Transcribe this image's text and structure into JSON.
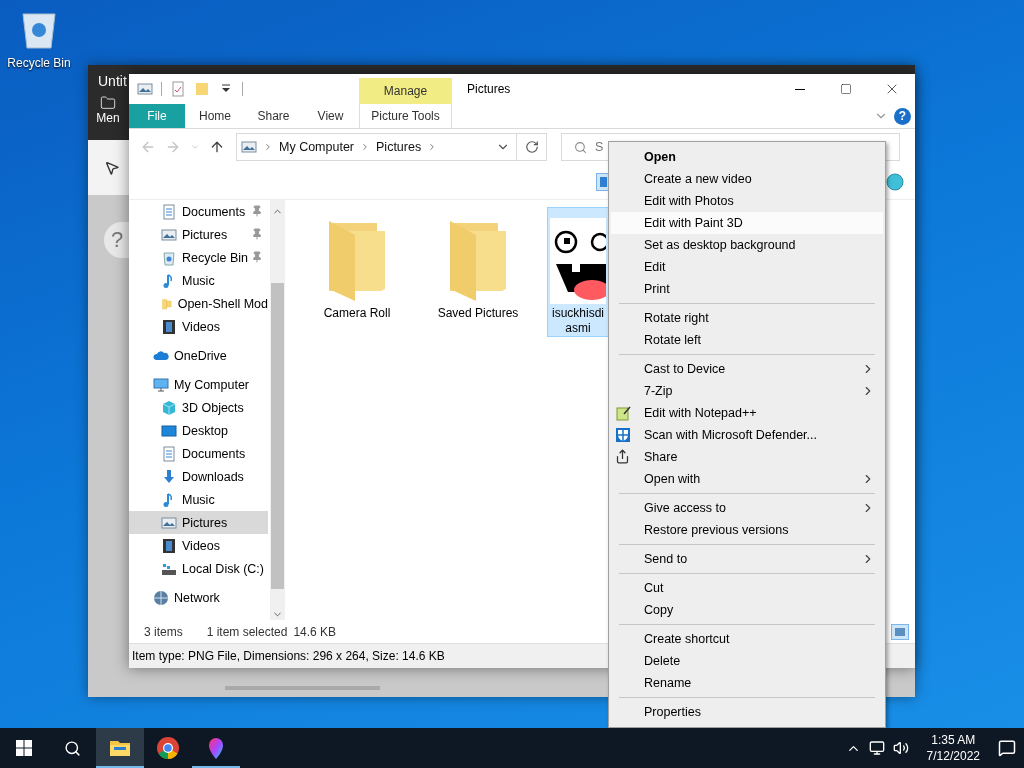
{
  "desktop": {
    "icons": [
      {
        "label": "Recycle Bin",
        "kind": "recycle"
      }
    ]
  },
  "background_window": {
    "title": "Untit",
    "menu_button": "Men",
    "help_button": "?"
  },
  "explorer": {
    "title": "Pictures",
    "help_icon": "?",
    "contextual_tab": {
      "header": "Manage",
      "tab": "Picture Tools"
    },
    "ribbon_tabs": [
      {
        "label": "File",
        "kind": "file",
        "selected": false
      },
      {
        "label": "Home",
        "kind": "plain",
        "selected": false
      },
      {
        "label": "Share",
        "kind": "plain",
        "selected": false
      },
      {
        "label": "View",
        "kind": "plain",
        "selected": false
      }
    ],
    "address": {
      "crumbs": [
        "My Computer",
        "Pictures"
      ]
    },
    "search": {
      "placeholder": "S"
    },
    "nav_pane": {
      "quick_access": [
        {
          "label": "Documents",
          "kind": "documents",
          "pinned": true,
          "selected": false
        },
        {
          "label": "Pictures",
          "kind": "pictures",
          "pinned": true,
          "selected": false
        },
        {
          "label": "Recycle Bin",
          "kind": "recycle",
          "pinned": true,
          "selected": false
        },
        {
          "label": "Music",
          "kind": "music",
          "pinned": false,
          "selected": false
        },
        {
          "label": "Open-Shell Mod",
          "kind": "folder",
          "pinned": false,
          "selected": false
        },
        {
          "label": "Videos",
          "kind": "videos",
          "pinned": false,
          "selected": false
        }
      ],
      "items": [
        {
          "label": "OneDrive",
          "kind": "onedrive",
          "selected": false
        },
        {
          "label": "My Computer",
          "kind": "computer",
          "selected": false,
          "children": [
            {
              "label": "3D Objects",
              "kind": "objects",
              "selected": false
            },
            {
              "label": "Desktop",
              "kind": "desktop",
              "selected": false
            },
            {
              "label": "Documents",
              "kind": "documents",
              "selected": false
            },
            {
              "label": "Downloads",
              "kind": "downloads",
              "selected": false
            },
            {
              "label": "Music",
              "kind": "music",
              "selected": false
            },
            {
              "label": "Pictures",
              "kind": "pictures",
              "selected": true
            },
            {
              "label": "Videos",
              "kind": "videos",
              "selected": false
            },
            {
              "label": "Local Disk (C:)",
              "kind": "disk",
              "selected": false
            }
          ]
        },
        {
          "label": "Network",
          "kind": "network",
          "selected": false
        }
      ]
    },
    "files": [
      {
        "name_lines": [
          "Camera Roll"
        ],
        "kind": "folder",
        "selected": false
      },
      {
        "name_lines": [
          "Saved Pictures"
        ],
        "kind": "folder",
        "selected": false
      },
      {
        "name_lines": [
          "isuckhisdi",
          "asmi"
        ],
        "selected": true
      }
    ],
    "status_bar": {
      "item_count": "3 items",
      "selection": "1 item selected",
      "size": "14.6 KB"
    },
    "details_pane": "Item type: PNG File, Dimensions: 296 x 264, Size: 14.6 KB"
  },
  "context_menu": {
    "groups": [
      [
        {
          "label": "Open",
          "kind": "plain",
          "bold": true,
          "highlighted": false,
          "submenu": false
        },
        {
          "label": "Create a new video",
          "kind": "plain",
          "bold": false,
          "highlighted": false,
          "submenu": false
        },
        {
          "label": "Edit with Photos",
          "kind": "plain",
          "bold": false,
          "highlighted": false,
          "submenu": false
        },
        {
          "label": "Edit with Paint 3D",
          "kind": "plain",
          "bold": false,
          "highlighted": true,
          "submenu": false
        },
        {
          "label": "Set as desktop background",
          "kind": "plain",
          "bold": false,
          "highlighted": false,
          "submenu": false
        },
        {
          "label": "Edit",
          "kind": "plain",
          "bold": false,
          "highlighted": false,
          "submenu": false
        },
        {
          "label": "Print",
          "kind": "plain",
          "bold": false,
          "highlighted": false,
          "submenu": false
        }
      ],
      [
        {
          "label": "Rotate right",
          "kind": "plain",
          "bold": false,
          "highlighted": false,
          "submenu": false
        },
        {
          "label": "Rotate left",
          "kind": "plain",
          "bold": false,
          "highlighted": false,
          "submenu": false
        }
      ],
      [
        {
          "label": "Cast to Device",
          "kind": "plain",
          "bold": false,
          "highlighted": false,
          "submenu": true
        },
        {
          "label": "7-Zip",
          "kind": "plain",
          "bold": false,
          "highlighted": false,
          "submenu": true
        },
        {
          "label": "Edit with Notepad++",
          "kind": "notepad",
          "bold": false,
          "highlighted": false,
          "submenu": false
        },
        {
          "label": "Scan with Microsoft Defender...",
          "kind": "defender",
          "bold": false,
          "highlighted": false,
          "submenu": false
        },
        {
          "label": "Share",
          "kind": "share",
          "bold": false,
          "highlighted": false,
          "submenu": false
        },
        {
          "label": "Open with",
          "kind": "plain",
          "bold": false,
          "highlighted": false,
          "submenu": true
        }
      ],
      [
        {
          "label": "Give access to",
          "kind": "plain",
          "bold": false,
          "highlighted": false,
          "submenu": true
        },
        {
          "label": "Restore previous versions",
          "kind": "plain",
          "bold": false,
          "highlighted": false,
          "submenu": false
        }
      ],
      [
        {
          "label": "Send to",
          "kind": "plain",
          "bold": false,
          "highlighted": false,
          "submenu": true
        }
      ],
      [
        {
          "label": "Cut",
          "kind": "plain",
          "bold": false,
          "highlighted": false,
          "submenu": false
        },
        {
          "label": "Copy",
          "kind": "plain",
          "bold": false,
          "highlighted": false,
          "submenu": false
        }
      ],
      [
        {
          "label": "Create shortcut",
          "kind": "plain",
          "bold": false,
          "highlighted": false,
          "submenu": false
        },
        {
          "label": "Delete",
          "kind": "plain",
          "bold": false,
          "highlighted": false,
          "submenu": false
        },
        {
          "label": "Rename",
          "kind": "plain",
          "bold": false,
          "highlighted": false,
          "submenu": false
        }
      ],
      [
        {
          "label": "Properties",
          "kind": "plain",
          "bold": false,
          "highlighted": false,
          "submenu": false
        }
      ]
    ]
  },
  "taskbar": {
    "apps": [
      {
        "kind": "explorer",
        "selected": true,
        "running": true
      },
      {
        "kind": "chrome",
        "selected": false,
        "running": false
      },
      {
        "kind": "paint",
        "selected": false,
        "running": true
      }
    ],
    "clock": {
      "time": "1:35 AM",
      "date": "7/12/2022"
    }
  }
}
